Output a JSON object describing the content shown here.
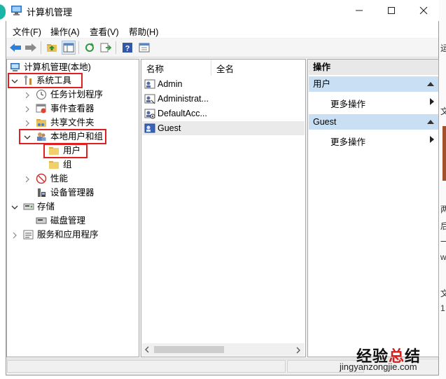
{
  "window": {
    "title": "计算机管理"
  },
  "menu": [
    {
      "label": "文件(F)"
    },
    {
      "label": "操作(A)"
    },
    {
      "label": "查看(V)"
    },
    {
      "label": "帮助(H)"
    }
  ],
  "toolbar": {
    "icons": [
      "back-arrow-icon",
      "forward-arrow-icon",
      "up-folder-icon",
      "show-hide-tree-icon",
      "refresh-icon",
      "export-list-icon",
      "help-icon",
      "properties-icon"
    ]
  },
  "tree": {
    "root": "计算机管理(本地)",
    "system_tools": "系统工具",
    "task_scheduler": "任务计划程序",
    "event_viewer": "事件查看器",
    "shared_folders": "共享文件夹",
    "local_users_groups": "本地用户和组",
    "users": "用户",
    "groups": "组",
    "performance": "性能",
    "device_manager": "设备管理器",
    "storage": "存储",
    "disk_management": "磁盘管理",
    "services_apps": "服务和应用程序"
  },
  "list": {
    "col_name": "名称",
    "col_fullname": "全名",
    "rows": [
      {
        "name": "Admin"
      },
      {
        "name": "Administrat..."
      },
      {
        "name": "DefaultAcc..."
      },
      {
        "name": "Guest"
      }
    ]
  },
  "actions": {
    "header": "操作",
    "section1": "用户",
    "section1_more": "更多操作",
    "section2": "Guest",
    "section2_more": "更多操作"
  },
  "edge_right_text": [
    "运",
    "文",
    "两",
    "后",
    "一",
    "w",
    "文",
    "1"
  ],
  "watermark": {
    "chars": [
      "经",
      "验",
      "总",
      "结"
    ],
    "colors": [
      "#111111",
      "#111111",
      "#d42020",
      "#111111"
    ],
    "url": "jingyanzongjie.com"
  }
}
